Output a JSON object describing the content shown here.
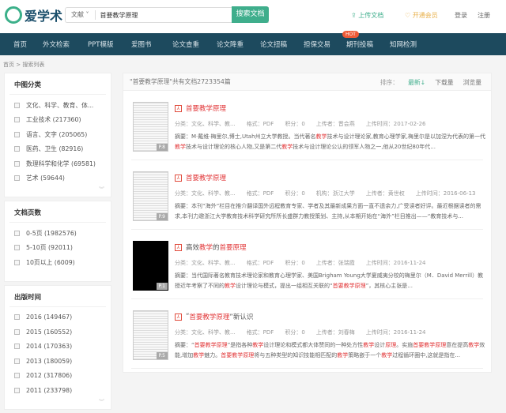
{
  "header": {
    "logo": "爱学术",
    "search_type": "文献",
    "query": "首要教学原理",
    "search_button": "搜索文档",
    "upload": "上传文档",
    "vip": "开通会员",
    "login": "登录",
    "register": "注册"
  },
  "nav": {
    "items": [
      "首页",
      "外文检索",
      "PPT模版",
      "爱图书",
      "论文查重",
      "论文降重",
      "论文扭稿",
      "担保交易",
      "期刊投稿",
      "知网检测"
    ],
    "hot": "HOT"
  },
  "breadcrumb": "首页 > 搜索列表",
  "filters": [
    {
      "title": "中图分类",
      "items": [
        "文化、科学、教育、体...",
        "工业技术 (217360)",
        "语言、文字 (205065)",
        "医药、卫生 (82916)",
        "数理科学和化学 (69581)",
        "艺术 (59644)"
      ]
    },
    {
      "title": "文档页数",
      "items": [
        "0-5页 (1982576)",
        "5-10页 (92011)",
        "10页以上 (6009)"
      ]
    },
    {
      "title": "出版时间",
      "items": [
        "2016 (149467)",
        "2015 (160552)",
        "2014 (170363)",
        "2013 (180059)",
        "2012 (317806)",
        "2011 (233798)"
      ]
    }
  ],
  "results_header": {
    "summary": "\"首要教学原理\"共有文档2723354篇",
    "sort_label": "排序：",
    "sort_latest": "最新↓",
    "sort_downloads": "下载量",
    "sort_views": "浏览量"
  },
  "colors": {
    "accent": "#3fae8c",
    "nav_bg": "#1d4a5e",
    "highlight": "#e2383a"
  },
  "results": [
    {
      "page": "P.8",
      "thumb": "doc",
      "title": [
        [
          "首要教学原理",
          1
        ]
      ],
      "meta": [
        "分类：文化、科学、教...",
        "格式：PDF",
        "积分：0",
        "上传者：晋会燕",
        "上传时间：2017-02-26"
      ],
      "abstract": [
        [
          "摘要：M·戴维·梅里尔,博士,Utah州立大学教授。当代著名",
          0
        ],
        [
          "教学",
          1
        ],
        [
          "技术与设计理论家,教育心理学家,梅里尔是以加涅为代表的第一代",
          0
        ],
        [
          "教学",
          1
        ],
        [
          "技术与设计理论的核心人物,又是第二代",
          0
        ],
        [
          "教学",
          1
        ],
        [
          "技术与设计理论公认的领军人物之一,他从20世纪80年代...",
          0
        ]
      ]
    },
    {
      "page": "P.9",
      "thumb": "doc",
      "title": [
        [
          "首要教学原理",
          1
        ]
      ],
      "meta": [
        "分类：文化、科学、教...",
        "格式：PDF",
        "积分：0",
        "机构：浙江大学",
        "上传者：黄世权",
        "上传时间：2016-06-13"
      ],
      "abstract": [
        [
          "摘要：本刊“海外”栏目在推介翻译国外远程教育专家、学者及其最新成果方面一直不遗余力,广受读者好评。最近根据读者的需求,本刊力邀浙江大学教育技术科学研究所所长盛群力教授策划、主持,从本期开始在“海外”栏目推出——“教育技术与...",
          0
        ]
      ]
    },
    {
      "page": "P.1",
      "thumb": "black",
      "title": [
        [
          "高效",
          0
        ],
        [
          "教学",
          1
        ],
        [
          "的",
          0
        ],
        [
          "首要原理",
          1
        ]
      ],
      "meta": [
        "分类：文化、科学、教...",
        "格式：PDF",
        "积分：0",
        "上传者：张瑞霞",
        "上传时间：2016-11-24"
      ],
      "abstract": [
        [
          "摘要：当代国际著名教育技术理论家和教育心理学家、美国Brigham Young大学夏威夷分校的梅里尔（M．David Merrill）教授近年考察了不同的",
          0
        ],
        [
          "教学",
          1
        ],
        [
          "设计理论与模式，提出一组相互关联的“",
          0
        ],
        [
          "首要教学原理",
          1
        ],
        [
          "”，其核心主张是...",
          0
        ]
      ]
    },
    {
      "page": "P.5",
      "thumb": "doc",
      "title": [
        [
          "“",
          0
        ],
        [
          "首要教学原理",
          1
        ],
        [
          "”新认识",
          0
        ]
      ],
      "meta": [
        "分类：文化、科学、教...",
        "格式：PDF",
        "积分：0",
        "上传者：刘春梅",
        "上传时间：2016-11-24"
      ],
      "abstract": [
        [
          "摘要：“",
          0
        ],
        [
          "首要教学原理",
          1
        ],
        [
          "”是指各种",
          0
        ],
        [
          "教学",
          1
        ],
        [
          "设计理论和模式都大体赞同的一种处方性",
          0
        ],
        [
          "教学",
          1
        ],
        [
          "设计",
          0
        ],
        [
          "原理",
          1
        ],
        [
          "。实施",
          0
        ],
        [
          "首要教学原理",
          1
        ],
        [
          "意在提高",
          0
        ],
        [
          "教学",
          1
        ],
        [
          "效能,增加",
          0
        ],
        [
          "教学",
          1
        ],
        [
          "魅力。",
          0
        ],
        [
          "首要教学原理",
          1
        ],
        [
          "将与五种类型的知识技能相匹配的",
          0
        ],
        [
          "教学",
          1
        ],
        [
          "策略嵌于一个",
          0
        ],
        [
          "教学",
          1
        ],
        [
          "过程循环圈中,这就是指在...",
          0
        ]
      ]
    }
  ]
}
